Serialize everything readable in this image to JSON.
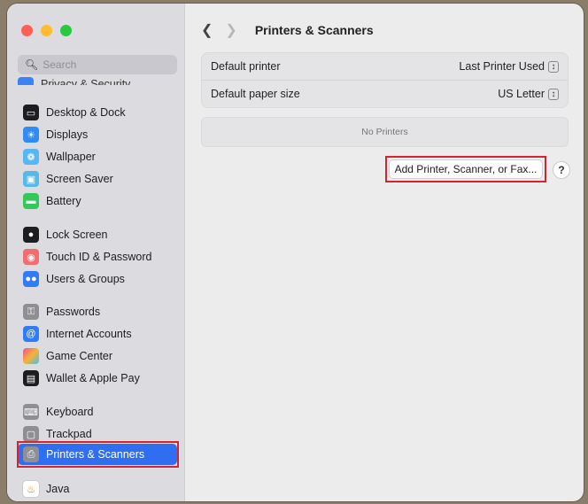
{
  "window": {
    "title": "Printers & Scanners"
  },
  "search": {
    "placeholder": "Search"
  },
  "sidebar": {
    "partial_item": {
      "label": "Privacy & Security",
      "icon": "hand-icon",
      "color": "#3b82f6"
    },
    "items": [
      {
        "label": "Desktop & Dock",
        "icon": "dock-icon",
        "color": "#1d1d1f"
      },
      {
        "label": "Displays",
        "icon": "sun-icon",
        "color": "#2f8cf5"
      },
      {
        "label": "Wallpaper",
        "icon": "flower-icon",
        "color": "#58b6f3"
      },
      {
        "label": "Screen Saver",
        "icon": "screen-saver-icon",
        "color": "#56b9e6"
      },
      {
        "label": "Battery",
        "icon": "battery-icon",
        "color": "#34c759"
      },
      {
        "label": "Lock Screen",
        "icon": "lock-icon",
        "color": "#1d1d1f"
      },
      {
        "label": "Touch ID & Password",
        "icon": "fingerprint-icon",
        "color": "#f26d6d"
      },
      {
        "label": "Users & Groups",
        "icon": "users-icon",
        "color": "#2f7cf6"
      },
      {
        "label": "Passwords",
        "icon": "key-icon",
        "color": "#8e8e93"
      },
      {
        "label": "Internet Accounts",
        "icon": "at-icon",
        "color": "#2f7cf6"
      },
      {
        "label": "Game Center",
        "icon": "game-center-icon",
        "color": "#e94f9b"
      },
      {
        "label": "Wallet & Apple Pay",
        "icon": "wallet-icon",
        "color": "#1d1d1f"
      },
      {
        "label": "Keyboard",
        "icon": "keyboard-icon",
        "color": "#8e8e93"
      },
      {
        "label": "Trackpad",
        "icon": "trackpad-icon",
        "color": "#8e8e93"
      },
      {
        "label": "Printers & Scanners",
        "icon": "printer-icon",
        "color": "#8e8e93",
        "selected": true
      },
      {
        "label": "Java",
        "icon": "java-icon",
        "color": "#ffffff"
      }
    ]
  },
  "settings": {
    "default_printer": {
      "label": "Default printer",
      "value": "Last Printer Used"
    },
    "default_paper": {
      "label": "Default paper size",
      "value": "US Letter"
    }
  },
  "printers": {
    "empty_text": "No Printers"
  },
  "actions": {
    "add_label": "Add Printer, Scanner, or Fax...",
    "help_label": "?"
  },
  "colors": {
    "accent": "#2f6ef1",
    "highlight": "#d7232f"
  }
}
